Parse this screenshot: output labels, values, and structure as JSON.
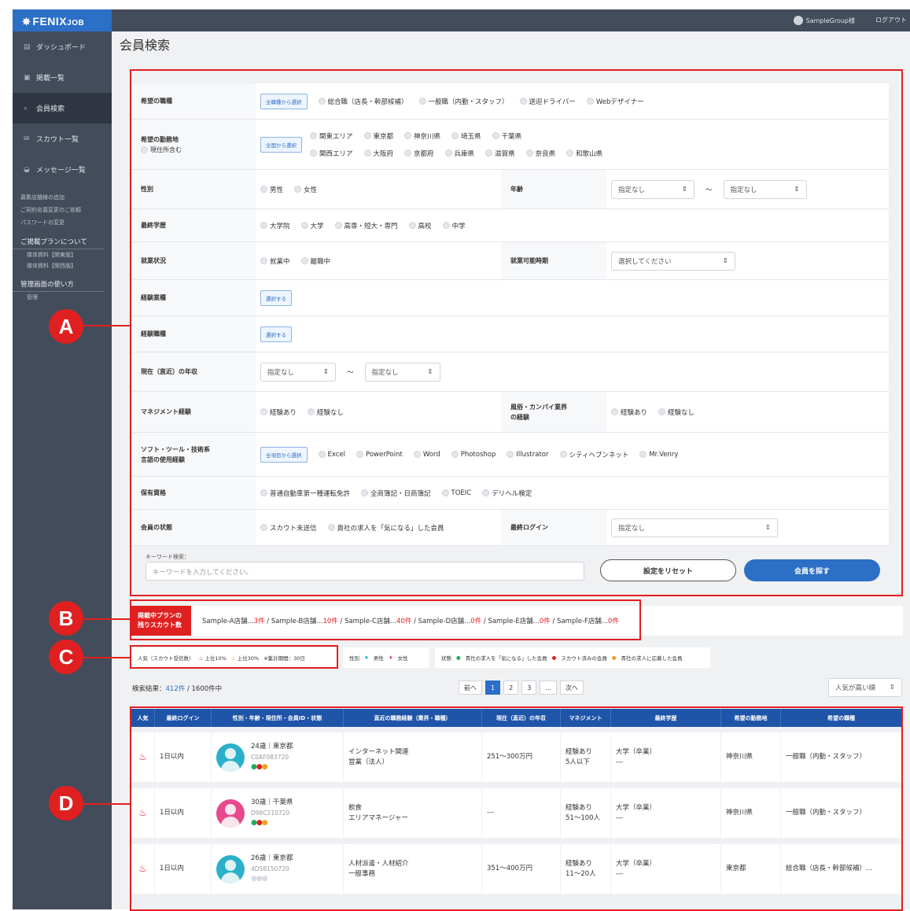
{
  "header": {
    "logo": "FENIX",
    "logo_small": "JOB",
    "user": "SampleGroup様",
    "logout": "ログアウト"
  },
  "sidebar": {
    "items": [
      {
        "icon": "▤",
        "label": "ダッシュボード"
      },
      {
        "icon": "▣",
        "label": "掲載一覧"
      },
      {
        "icon": "⌕",
        "label": "会員検索"
      },
      {
        "icon": "✉",
        "label": "スカウト一覧"
      },
      {
        "icon": "◒",
        "label": "メッセージ一覧"
      }
    ],
    "links": [
      "募集店舗様の追加",
      "ご契約名義変更のご依頼",
      "パスワードの変更"
    ],
    "plan_title": "ご掲載プランについて",
    "plan_links": [
      "媒体資料【関東版】",
      "媒体資料【関西版】"
    ],
    "guide_title": "管理画面の使い方",
    "guide_links": [
      "管理"
    ]
  },
  "page_title": "会員検索",
  "form": {
    "job": {
      "label": "希望の職種",
      "btn": "全職種から選択",
      "opts": [
        "総合職（店長・幹部候補）",
        "一般職（内勤・スタッフ）",
        "送迎ドライバー",
        "Webデザイナー"
      ]
    },
    "area": {
      "label": "希望の勤務地",
      "sub": "現住所含む",
      "btn": "全国から選択",
      "row1": [
        "関東エリア",
        "東京都",
        "神奈川県",
        "埼玉県",
        "千葉県"
      ],
      "row2": [
        "関西エリア",
        "大阪府",
        "京都府",
        "兵庫県",
        "滋賀県",
        "奈良県",
        "和歌山県"
      ]
    },
    "gender": {
      "label": "性別",
      "opts": [
        "男性",
        "女性"
      ]
    },
    "age": {
      "label": "年齢",
      "from": "指定なし",
      "to": "指定なし",
      "sep": "〜"
    },
    "edu": {
      "label": "最終学歴",
      "opts": [
        "大学院",
        "大学",
        "高専・短大・専門",
        "高校",
        "中学"
      ]
    },
    "work": {
      "label": "就業状況",
      "opts": [
        "就業中",
        "離職中"
      ]
    },
    "avail": {
      "label": "就業可能時期",
      "value": "選択してください"
    },
    "exp_ind": {
      "label": "経験業種",
      "btn": "選択する"
    },
    "exp_job": {
      "label": "経験職種",
      "btn": "選択する"
    },
    "income": {
      "label": "現在（直近）の年収",
      "from": "指定なし",
      "to": "指定なし",
      "sep": "〜"
    },
    "mgmt": {
      "label": "マネジメント経験",
      "opts": [
        "経験あり",
        "経験なし"
      ]
    },
    "fuzoku": {
      "label1": "風俗・カンパイ業界",
      "label2": "の経験",
      "opts": [
        "経験あり",
        "経験なし"
      ]
    },
    "soft": {
      "label1": "ソフト・ツール・技術系",
      "label2": "言語の使用経験",
      "btn": "全項目から選択",
      "opts": [
        "Excel",
        "PowerPoint",
        "Word",
        "Photoshop",
        "Illustrator",
        "シティヘブンネット",
        "Mr.Venry"
      ]
    },
    "license": {
      "label": "保有資格",
      "opts": [
        "普通自動車第一種運転免許",
        "全商簿記・日商簿記",
        "TOEIC",
        "デリヘル検定"
      ]
    },
    "status": {
      "label": "会員の状態",
      "opts": [
        "スカウト未送信",
        "貴社の求人を「気になる」した会員"
      ]
    },
    "last": {
      "label": "最終ログイン",
      "value": "指定なし"
    },
    "kw_label": "キーワード検索：",
    "kw_placeholder": "キーワードを入力してください。",
    "reset": "設定をリセット",
    "search": "会員を探す"
  },
  "plans": {
    "tag1": "掲載中プランの",
    "tag2": "残りスカウト数",
    "items": [
      {
        "name": "Sample-A店舗...",
        "count": "3件"
      },
      {
        "name": "Sample-B店舗...",
        "count": "10件"
      },
      {
        "name": "Sample-C店舗...",
        "count": "40件"
      },
      {
        "name": "Sample-D店舗...",
        "count": "0件"
      },
      {
        "name": "Sample-E店舗...",
        "count": "0件"
      },
      {
        "name": "Sample-F店舗...",
        "count": "0件"
      }
    ]
  },
  "legend": {
    "pop": "人気（スカウト受信数）",
    "top10": "上位10%",
    "top30": "上位30%",
    "period": "※集計期間：30日",
    "gender": "性別",
    "male": "男性",
    "female": "女性",
    "state": "状態",
    "s1": "貴社の求人を「気になる」した会員",
    "s2": "スカウト済みの会員",
    "s3": "貴社の求人に応募した会員"
  },
  "results": {
    "count": "412件",
    "total": " / 1600件中",
    "prefix": "検索結果："
  },
  "pager": {
    "prev": "前へ",
    "pages": [
      "1",
      "2",
      "3",
      "..."
    ],
    "next": "次へ"
  },
  "sort": "人気が高い順",
  "table": {
    "headers": [
      "人気",
      "最終ログイン",
      "性別・年齢・現住所・会員ID・状態",
      "直近の職務経験（業界・職種）",
      "現在（直近）の年収",
      "マネジメント",
      "最終学歴",
      "希望の勤務地",
      "希望の職種"
    ],
    "rows": [
      {
        "login": "1日以内",
        "profile": "24歳｜東京都",
        "id": "C0AF083720",
        "ind": "インターネット関連",
        "job": "営業（法人）",
        "income": "251〜300万円",
        "m1": "経験あり",
        "m2": "5人以下",
        "e1": "大学（卒業）",
        "e2": "---",
        "loc": "神奈川県",
        "want": "一般職（内勤・スタッフ）"
      },
      {
        "login": "1日以内",
        "profile": "30歳｜千葉県",
        "id": "D98C210720",
        "ind": "飲食",
        "job": "エリアマネージャー",
        "income": "---",
        "m1": "経験あり",
        "m2": "51〜100人",
        "e1": "大学（卒業）",
        "e2": "---",
        "loc": "神奈川県",
        "want": "一般職（内勤・スタッフ）"
      },
      {
        "login": "1日以内",
        "profile": "26歳｜東京都",
        "id": "4D58150720",
        "ind": "人材派遣・人材紹介",
        "job": "一般事務",
        "income": "351〜400万円",
        "m1": "経験あり",
        "m2": "11〜20人",
        "e1": "大学（卒業）",
        "e2": "---",
        "loc": "東京都",
        "want": "総合職（店長・幹部候補）..."
      }
    ]
  },
  "callouts": [
    "A",
    "B",
    "C",
    "D"
  ],
  "colors": {
    "primary": "#2c6fc6",
    "accent": "#e02020",
    "header": "#1f55a8",
    "sidebar": "#434c5a",
    "male": "#2bb0c9",
    "female": "#e64a8c"
  }
}
